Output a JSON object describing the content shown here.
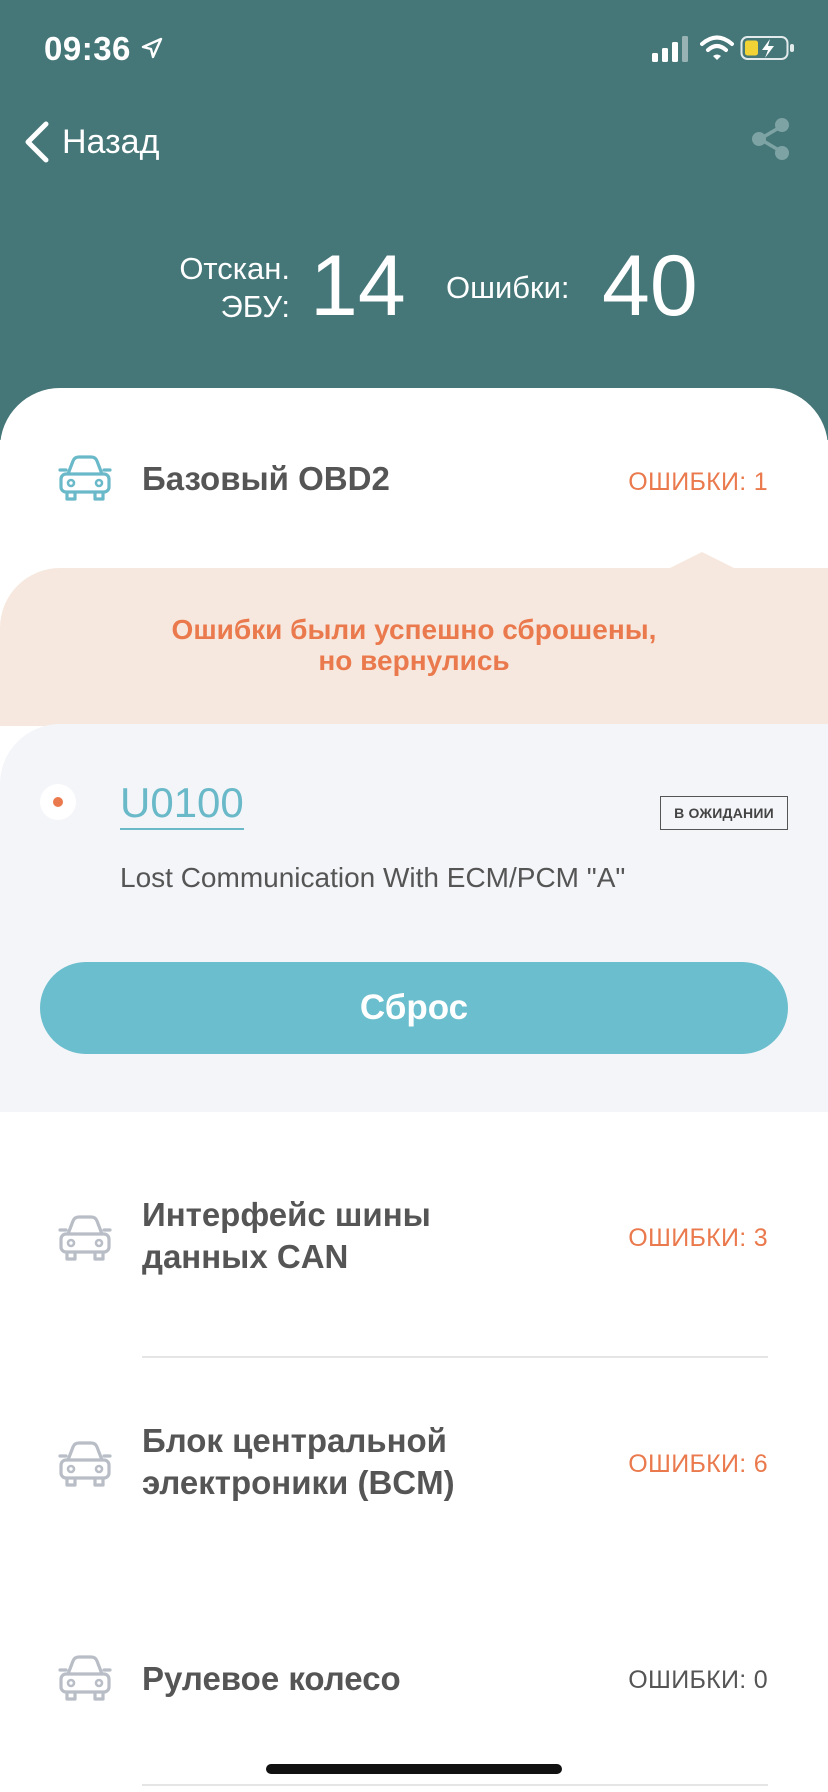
{
  "status_bar": {
    "time": "09:36"
  },
  "nav": {
    "back_label": "Назад"
  },
  "summary": {
    "scanned_label_line1": "Отскан.",
    "scanned_label_line2": "ЭБУ:",
    "scanned_value": "14",
    "errors_label": "Ошибки:",
    "errors_value": "40"
  },
  "ecus": [
    {
      "name_line1": "Базовый OBD2",
      "name_line2": "",
      "errors": "ОШИБКИ: 1",
      "highlight": true
    },
    {
      "name_line1": "Интерфейс шины",
      "name_line2": "данных CAN",
      "errors": "ОШИБКИ: 3",
      "highlight": false
    },
    {
      "name_line1": "Блок центральной",
      "name_line2": "электроники (BCM)",
      "errors": "ОШИБКИ: 6",
      "highlight": false
    },
    {
      "name_line1": "Рулевое колесо",
      "name_line2": "",
      "errors": "ОШИБКИ: 0",
      "highlight": false
    }
  ],
  "warning": {
    "line1": "Ошибки были успешно сброшены,",
    "line2": "но вернулись"
  },
  "dtc": {
    "code": "U0100",
    "status": "В ОЖИДАНИИ",
    "description": "Lost Communication With ECM/PCM \"A\""
  },
  "reset_button_label": "Сброс",
  "colors": {
    "header_bg": "#457678",
    "accent_teal": "#6bbecd",
    "error_orange": "#ea7a4d",
    "warning_bg": "#f6e8de",
    "panel_bg": "#f4f5f9"
  }
}
